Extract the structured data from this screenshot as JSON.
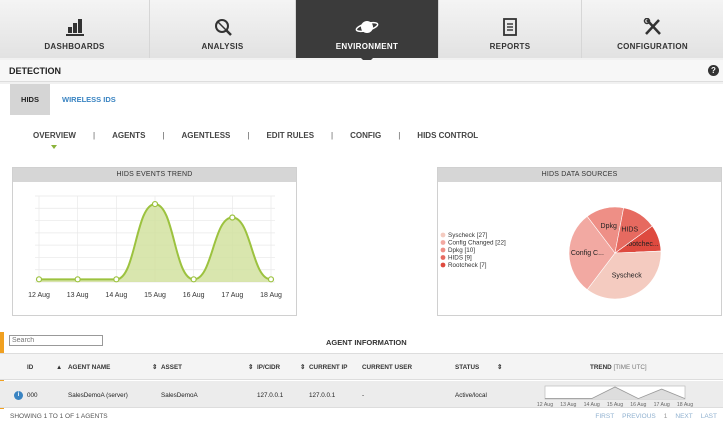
{
  "nav": {
    "items": [
      {
        "label": "DASHBOARDS",
        "icon": "bar-chart-icon"
      },
      {
        "label": "ANALYSIS",
        "icon": "magnifier-icon"
      },
      {
        "label": "ENVIRONMENT",
        "icon": "planet-icon",
        "active": true
      },
      {
        "label": "REPORTS",
        "icon": "document-icon"
      },
      {
        "label": "CONFIGURATION",
        "icon": "tools-icon"
      }
    ]
  },
  "detection": {
    "title": "DETECTION",
    "help": "?"
  },
  "subtabs": {
    "hids": "HIDS",
    "wireless": "WIRELESS IDS"
  },
  "hidsnav": {
    "overview": "OVERVIEW",
    "agents": "AGENTS",
    "agentless": "AGENTLESS",
    "edit_rules": "EDIT RULES",
    "config": "CONFIG",
    "hids_control": "HIDS CONTROL",
    "sep": "|"
  },
  "trend_widget": {
    "title": "HIDS EVENTS TREND"
  },
  "sources_widget": {
    "title": "HIDS DATA SOURCES"
  },
  "chart_data": [
    {
      "type": "area",
      "title": "HIDS EVENTS TREND",
      "categories": [
        "12 Aug",
        "13 Aug",
        "14 Aug",
        "15 Aug",
        "16 Aug",
        "17 Aug",
        "18 Aug"
      ],
      "values": [
        1,
        1,
        1,
        29,
        1,
        24,
        1
      ],
      "ylim": [
        0,
        32
      ],
      "grid": true,
      "color": "#9cc23f",
      "fill": "#cfe09a"
    },
    {
      "type": "pie",
      "title": "HIDS DATA SOURCES",
      "slices": [
        {
          "label": "Syscheck",
          "legend": "Syscheck [27]",
          "value": 27,
          "color": "#f4cbc0"
        },
        {
          "label": "Config C...",
          "legend": "Config Changed [22]",
          "value": 22,
          "color": "#f2a9a2"
        },
        {
          "label": "Dpkg",
          "legend": "Dpkg [10]",
          "value": 10,
          "color": "#ee8f86"
        },
        {
          "label": "HIDS",
          "legend": "HIDS [9]",
          "value": 9,
          "color": "#e66a60"
        },
        {
          "label": "Rootchec...",
          "legend": "Rootcheck [7]",
          "value": 7,
          "color": "#de4a3f"
        }
      ]
    }
  ],
  "agents": {
    "search_placeholder": "Search",
    "title": "AGENT INFORMATION",
    "columns": {
      "id": "ID",
      "name": "AGENT NAME",
      "asset": "ASSET",
      "ip": "IP/CIDR",
      "current_ip": "CURRENT IP",
      "current_user": "CURRENT USER",
      "status": "STATUS",
      "trend": "TREND",
      "trend_unit": "[TIME UTC]"
    },
    "rows": [
      {
        "id": "000",
        "name": "SalesDemoA (server)",
        "asset": "SalesDemoA",
        "ip": "127.0.0.1",
        "current_ip": "127.0.0.1",
        "current_user": "-",
        "status": "Active/local"
      }
    ],
    "trend_labels": [
      "12 Aug",
      "13 Aug",
      "14 Aug",
      "15 Aug",
      "16 Aug",
      "17 Aug",
      "18 Aug"
    ],
    "showing": "SHOWING 1 TO 1 OF 1 AGENTS",
    "pager": {
      "first": "FIRST",
      "previous": "PREVIOUS",
      "page": "1",
      "next": "NEXT",
      "last": "LAST"
    }
  },
  "colors": {
    "active_nav": "#3b3b3b",
    "link": "#3a84c2",
    "accent": "#8ab33a"
  }
}
